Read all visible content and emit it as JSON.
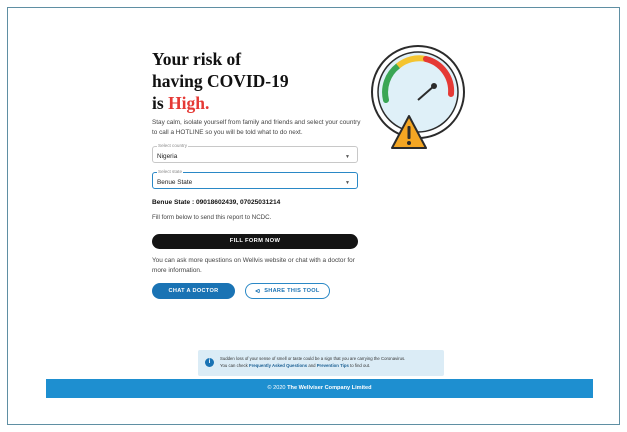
{
  "result": {
    "heading_line1": "Your risk of",
    "heading_line2": "having COVID-19",
    "heading_is": "is",
    "risk_level": "High.",
    "risk_color": "#e53935",
    "intro": "Stay calm, isolate yourself from family and friends and select your country to call a HOTLINE so you will be told what to do next."
  },
  "form": {
    "country_label": "Select country",
    "country_value": "Nigeria",
    "state_label": "Select state",
    "state_value": "Benue State"
  },
  "hotline": "Benue State : 09018602439, 07025031214",
  "fill_note": "Fill form below to send this report to NCDC.",
  "buttons": {
    "fill_form": "FILL FORM NOW",
    "chat_doctor": "CHAT A DOCTOR",
    "share_tool": "SHARE THIS TOOL"
  },
  "more_info": "You can ask more questions on Wellvis website or chat with a doctor for more information.",
  "notice": {
    "text_part1": "Sudden loss of your sense of smell or taste could be a sign that you are carrying the Coronavirus.",
    "text_part2": "You can check",
    "link1": "Frequently Asked Questions",
    "text_part3": "and",
    "link2": "Prevention Tips",
    "text_part4": "to find out."
  },
  "footer": {
    "year": "© 2020",
    "company": "The Wellviser Company Limited"
  },
  "colors": {
    "primary": "#1a73b4",
    "footer": "#1e8fd0",
    "warning": "#f4a623",
    "danger": "#e53935"
  },
  "icons": {
    "gauge": "risk-gauge-icon",
    "warning": "warning-triangle-icon",
    "share": "share-icon",
    "info": "info-icon"
  }
}
